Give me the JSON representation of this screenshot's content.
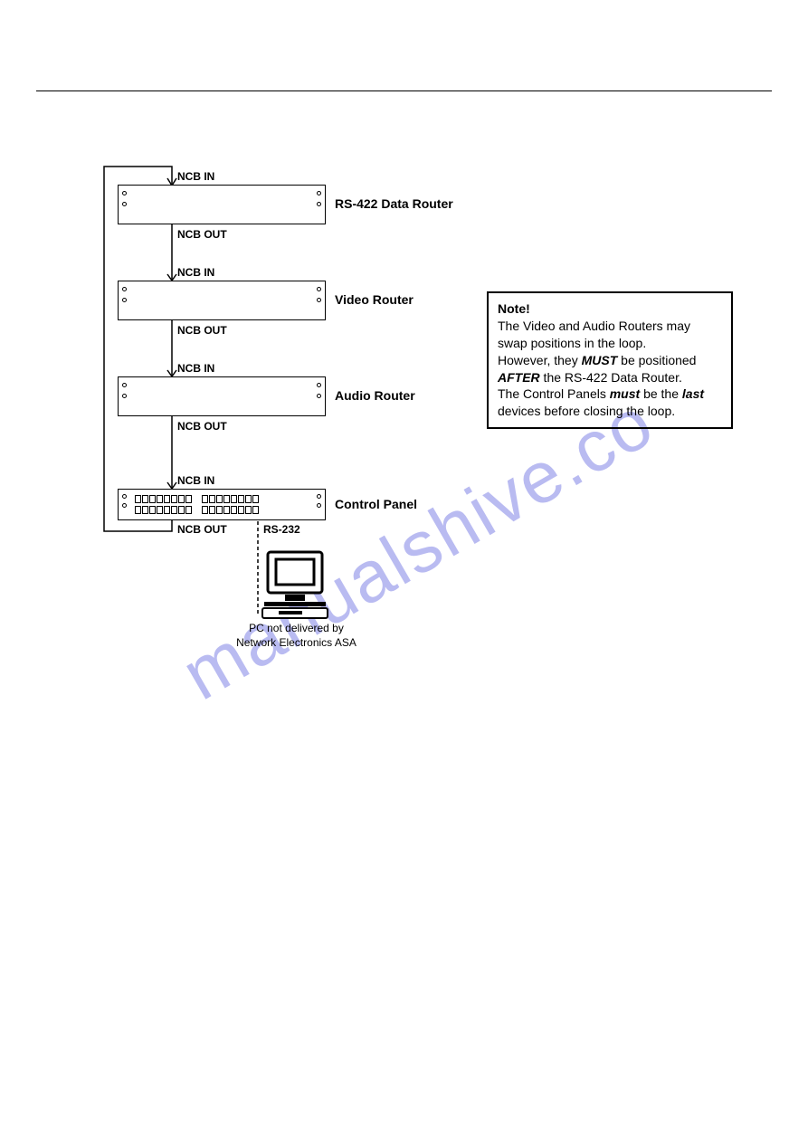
{
  "labels": {
    "ncb_in": "NCB IN",
    "ncb_out": "NCB OUT",
    "rs232": "RS-232"
  },
  "devices": {
    "rs422": "RS-422 Data Router",
    "video": "Video Router",
    "audio": "Audio Router",
    "panel": "Control Panel"
  },
  "note": {
    "title": "Note!",
    "line1a": "The Video and Audio Routers may swap positions in the loop.",
    "line2a": "However, they ",
    "line2b": "MUST",
    "line2c": " be positioned ",
    "line3a": "AFTER",
    "line3b": " the RS-422 Data Router.",
    "line4a": "The Control Panels ",
    "line4b": "must",
    "line4c": " be the ",
    "line4d": "last",
    "line4e": " devices before closing the loop."
  },
  "pc": {
    "line1": "PC not delivered by",
    "line2": "Network Electronics ASA"
  },
  "watermark": "manualshive.co"
}
